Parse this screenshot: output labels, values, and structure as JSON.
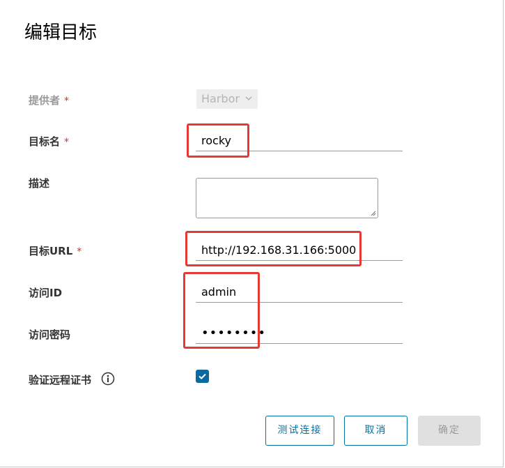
{
  "dialog": {
    "title": "编辑目标"
  },
  "form": {
    "provider": {
      "label": "提供者",
      "required_mark": "*",
      "value": "Harbor"
    },
    "target_name": {
      "label": "目标名",
      "required_mark": "*",
      "value": "rocky"
    },
    "description": {
      "label": "描述",
      "value": ""
    },
    "target_url": {
      "label": "目标URL",
      "required_mark": "*",
      "value": "http://192.168.31.166:5000"
    },
    "access_id": {
      "label": "访问ID",
      "value": "admin"
    },
    "access_secret": {
      "label": "访问密码",
      "value": "••••••••"
    },
    "verify_cert": {
      "label": "验证远程证书",
      "checked": true
    }
  },
  "buttons": {
    "test": "测试连接",
    "cancel": "取消",
    "ok": "确定"
  },
  "colors": {
    "accent": "#0072a3",
    "checkbox": "#0b6aa2",
    "highlight": "#e53935"
  }
}
